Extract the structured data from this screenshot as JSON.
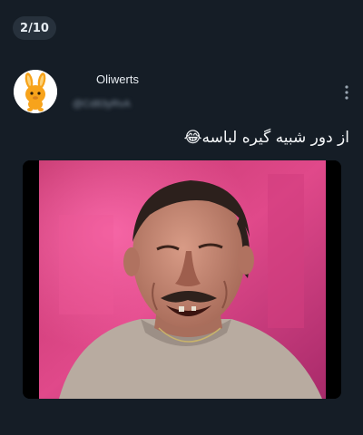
{
  "viewer": {
    "counter": "2/10"
  },
  "post": {
    "author_name": "Oliwerts",
    "author_handle": "@Cd83yRvA",
    "text": "از دور شبیه گیره لباسه😂",
    "avatar_icon": "orange-bunny-icon",
    "more_icon": "vertical-dots-icon",
    "media_subject": "laughing-man-photo"
  },
  "colors": {
    "background": "#151d26",
    "counter_bg": "#27313c",
    "text_primary": "#f4f6f8",
    "text_secondary": "#8391a0",
    "avatar_accent": "#f7a31b"
  }
}
